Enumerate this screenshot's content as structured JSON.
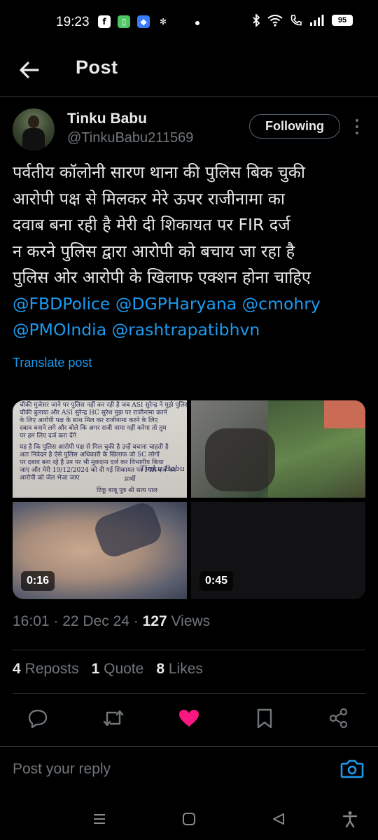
{
  "status_bar": {
    "time": "19:23",
    "battery": "95",
    "left_icons": [
      "facebook-icon",
      "app-icon",
      "app-icon",
      "app-icon"
    ],
    "right_icons": [
      "bluetooth-icon",
      "wifi-icon",
      "call-icon",
      "signal-icon",
      "battery-icon"
    ]
  },
  "header": {
    "title": "Post"
  },
  "author": {
    "name": "Tinku Babu",
    "handle": "@TinkuBabu211569",
    "follow_label": "Following"
  },
  "post": {
    "lines": [
      "पर्वतीय कॉलोनी सारण थाना की पुलिस बिक चुकी",
      "आरोपी पक्ष से मिलकर मेरे ऊपर राजीनामा का",
      "दवाब बना रही है मेरी दी शिकायत पर FIR दर्ज",
      "न करने पुलिस द्वारा आरोपी को बचाय जा रहा है",
      "पुलिस ओर आरोपी के खिलाफ एक्शन होना चाहिए"
    ],
    "mentions_line1": [
      "@FBDPolice",
      "@DGPHaryana",
      "@cmohry"
    ],
    "mentions_line2": [
      "@PMOIndia",
      "@rashtrapatibhvn"
    ],
    "translate_label": "Translate post"
  },
  "media": {
    "doc_lines": [
      "चौकी मुजेसर जाने पर पुलिस नहीं कर रही है जब ASI सुरेन्द्र ने मुझे पुलिस",
      "चौकी बुलाया और ASI सुरेन्द्र HC सुरेश मुझ पर राजीनामा करने",
      "के लिए आरोपी पक्ष के साथ मिल कर राजीनामा करने के लिए",
      "दबाव बनाने लगे और बोले कि अगर राजी नामा नहीं करेगा तो तुम",
      "पर हम लिए दर्ज करा देंगे",
      "यह है कि पुलिस आरोपी पक्ष से मिल चुकी है उन्हें बचाना चाहती है",
      "अतः निवेदन है ऐसे पुलिस अधिकारी के खिलाफ जो SC लोगों",
      "पर दबाव बना रहे है उन पर भी मुकदमा दर्ज कर विभागीय किया",
      "जाए और मेरी 19/12/2024 को दी गई शिकायत पर FIR दर्ज कर",
      "आरोपी को जेल भेजा जाए"
    ],
    "doc_signature": "Tinku Babu",
    "doc_sign_label": "प्रार्थी",
    "doc_sign_name": "टिंकू बाबू पुत्र श्री सत्य पाल",
    "durations": [
      "0:16",
      "0:45"
    ]
  },
  "meta": {
    "time": "16:01",
    "date": "22 Dec 24",
    "views_count": "127",
    "views_label": "Views"
  },
  "stats": {
    "reposts_count": "4",
    "reposts_label": "Reposts",
    "quotes_count": "1",
    "quotes_label": "Quote",
    "likes_count": "8",
    "likes_label": "Likes"
  },
  "reply": {
    "placeholder": "Post your reply"
  },
  "colors": {
    "background": "#000000",
    "text": "#e7e9ea",
    "secondary": "#71767b",
    "accent": "#1d9bf0",
    "like": "#f91880",
    "divider": "#2f3336"
  }
}
